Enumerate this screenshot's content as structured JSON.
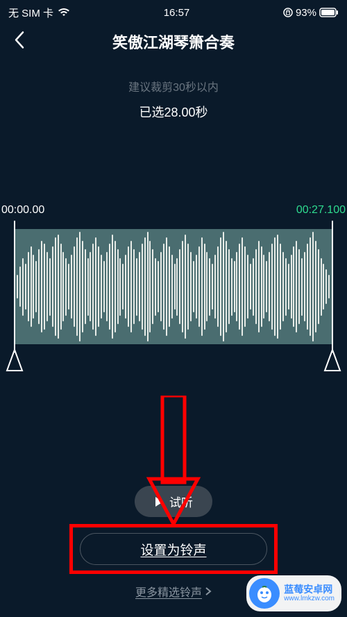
{
  "status_bar": {
    "sim": "无 SIM 卡",
    "time": "16:57",
    "battery_percent": "93%"
  },
  "nav": {
    "title": "笑傲江湖琴箫合奏"
  },
  "instructions": {
    "hint": "建议裁剪30秒以内",
    "selected": "已选28.00秒"
  },
  "waveform": {
    "start_time": "00:00.00",
    "end_time": "00:27.100"
  },
  "buttons": {
    "preview": "试听",
    "set_ringtone": "设置为铃声",
    "more": "更多精选铃声"
  },
  "watermark": {
    "title": "蓝莓安卓网",
    "url": "www.lmkzw.com"
  }
}
